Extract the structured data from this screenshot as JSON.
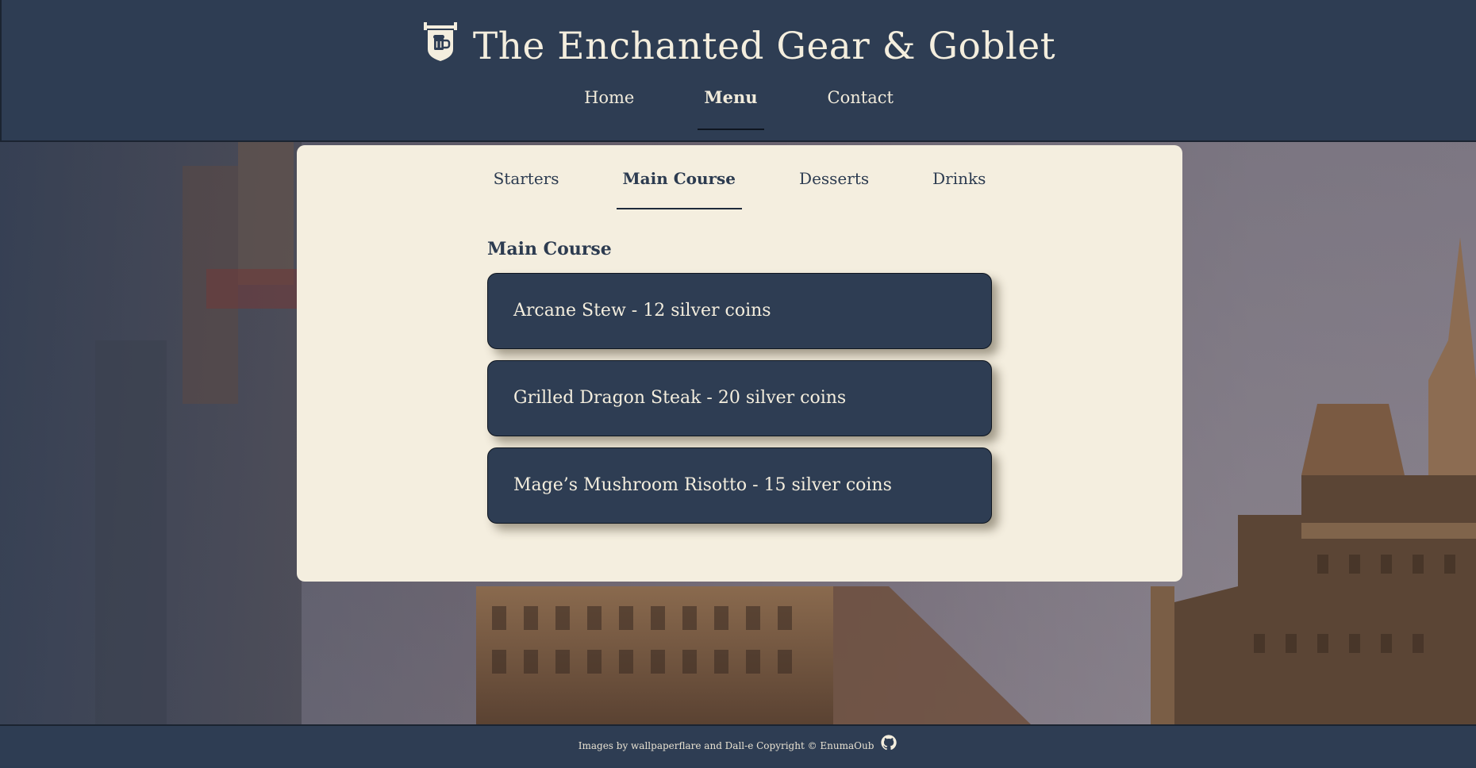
{
  "site": {
    "title": "The Enchanted Gear & Goblet",
    "logo_icon": "tavern-sign-icon"
  },
  "nav": {
    "items": [
      {
        "label": "Home",
        "active": false
      },
      {
        "label": "Menu",
        "active": true
      },
      {
        "label": "Contact",
        "active": false
      }
    ]
  },
  "menu": {
    "tabs": [
      {
        "label": "Starters",
        "active": false
      },
      {
        "label": "Main Course",
        "active": true
      },
      {
        "label": "Desserts",
        "active": false
      },
      {
        "label": "Drinks",
        "active": false
      }
    ],
    "section_title": "Main Course",
    "items": [
      {
        "text": "Arcane Stew - 12 silver coins"
      },
      {
        "text": "Grilled Dragon Steak - 20 silver coins"
      },
      {
        "text": "Mage’s Mushroom Risotto - 15 silver coins"
      }
    ]
  },
  "footer": {
    "text": "Images by wallpaperflare and Dall-e Copyright © EnumaOub",
    "icon": "github-icon"
  },
  "colors": {
    "header_bg": "#2e3d53",
    "card_bg": "#f4eedf",
    "text_light": "#f4eede",
    "text_dark": "#2c3b50"
  }
}
